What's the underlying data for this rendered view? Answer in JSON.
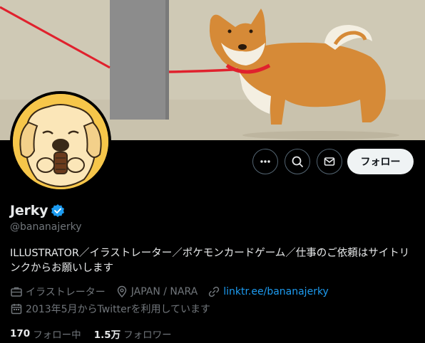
{
  "profile": {
    "display_name": "Jerky",
    "handle": "@bananajerky",
    "bio": "ILLUSTRATOR／イラストレーター／ポケモンカードゲーム／仕事のご依頼はサイトリンクからお願いします",
    "verified": true,
    "category": "イラストレーター",
    "location": "JAPAN / NARA",
    "website": "linktr.ee/bananajerky",
    "joined": "2013年5月からTwitterを利用しています"
  },
  "actions": {
    "follow_label": "フォロー"
  },
  "stats": {
    "following_count": "170",
    "following_label": "フォロー中",
    "followers_count": "1.5万",
    "followers_label": "フォロワー"
  },
  "icons": {
    "more": "more-icon",
    "search": "search-icon",
    "message": "mail-icon",
    "verified": "verified-badge-icon",
    "category": "briefcase-icon",
    "location": "location-pin-icon",
    "link": "link-icon",
    "calendar": "calendar-icon"
  },
  "colors": {
    "accent": "#1d9bf0",
    "background": "#000000",
    "muted": "#71767b",
    "avatar_bg": "#f6c64a",
    "leash": "#e0212d",
    "dog": "#d68a37"
  }
}
